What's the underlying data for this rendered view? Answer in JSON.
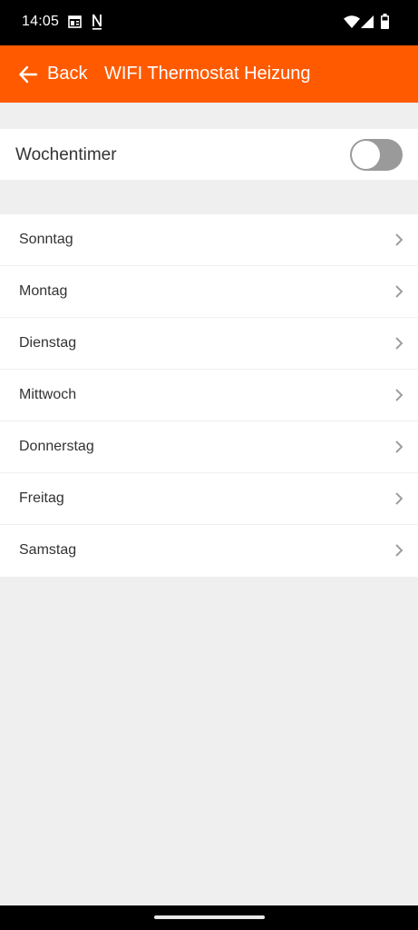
{
  "status_bar": {
    "time": "14:05"
  },
  "app_bar": {
    "back_label": "Back",
    "title": "WIFI Thermostat Heizung"
  },
  "weekly_timer": {
    "label": "Wochentimer",
    "enabled": false
  },
  "days": [
    {
      "label": "Sonntag"
    },
    {
      "label": "Montag"
    },
    {
      "label": "Dienstag"
    },
    {
      "label": "Mittwoch"
    },
    {
      "label": "Donnerstag"
    },
    {
      "label": "Freitag"
    },
    {
      "label": "Samstag"
    }
  ],
  "colors": {
    "accent": "#ff5a00",
    "background": "#efefef",
    "toggle_off": "#9a9a9a"
  }
}
